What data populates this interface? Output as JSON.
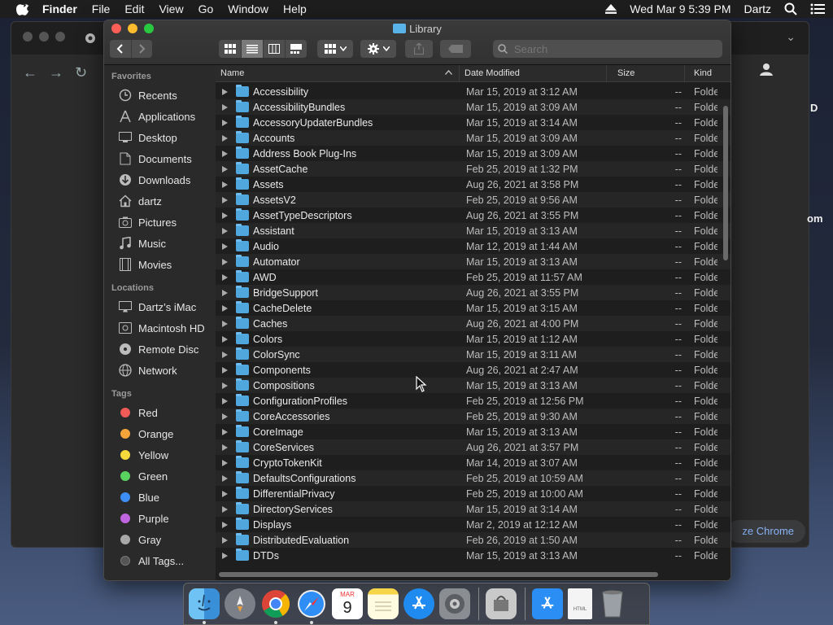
{
  "menubar": {
    "app": "Finder",
    "items": [
      "File",
      "Edit",
      "View",
      "Go",
      "Window",
      "Help"
    ],
    "datetime": "Wed Mar 9  5:39 PM",
    "user": "Dartz"
  },
  "chrome_background": {
    "edge_texts": [
      "D",
      "om"
    ],
    "customize_label": "ze Chrome"
  },
  "finder": {
    "title": "Library",
    "search_placeholder": "Search",
    "columns": {
      "name": "Name",
      "date": "Date Modified",
      "size": "Size",
      "kind": "Kind"
    },
    "sidebar": {
      "favorites_header": "Favorites",
      "favorites": [
        {
          "label": "Recents",
          "icon": "clock-icon"
        },
        {
          "label": "Applications",
          "icon": "applications-icon"
        },
        {
          "label": "Desktop",
          "icon": "desktop-icon"
        },
        {
          "label": "Documents",
          "icon": "document-icon"
        },
        {
          "label": "Downloads",
          "icon": "download-icon"
        },
        {
          "label": "dartz",
          "icon": "home-icon"
        },
        {
          "label": "Pictures",
          "icon": "camera-icon"
        },
        {
          "label": "Music",
          "icon": "music-icon"
        },
        {
          "label": "Movies",
          "icon": "film-icon"
        }
      ],
      "locations_header": "Locations",
      "locations": [
        {
          "label": "Dartz’s iMac",
          "icon": "imac-icon"
        },
        {
          "label": "Macintosh HD",
          "icon": "disk-icon"
        },
        {
          "label": "Remote Disc",
          "icon": "disc-icon"
        },
        {
          "label": "Network",
          "icon": "globe-icon"
        }
      ],
      "tags_header": "Tags",
      "tags": [
        {
          "label": "Red",
          "color": "#f05a57"
        },
        {
          "label": "Orange",
          "color": "#f7a43a"
        },
        {
          "label": "Yellow",
          "color": "#f5d93d"
        },
        {
          "label": "Green",
          "color": "#5ad25f"
        },
        {
          "label": "Blue",
          "color": "#3e8ff5"
        },
        {
          "label": "Purple",
          "color": "#c065e0"
        },
        {
          "label": "Gray",
          "color": "#a8a8a8"
        },
        {
          "label": "All Tags...",
          "color": "#555555"
        }
      ]
    },
    "rows": [
      {
        "name": "Accessibility",
        "date": "Mar 15, 2019 at 3:12 AM",
        "size": "--",
        "kind": "Folde"
      },
      {
        "name": "AccessibilityBundles",
        "date": "Mar 15, 2019 at 3:09 AM",
        "size": "--",
        "kind": "Folde"
      },
      {
        "name": "AccessoryUpdaterBundles",
        "date": "Mar 15, 2019 at 3:14 AM",
        "size": "--",
        "kind": "Folde"
      },
      {
        "name": "Accounts",
        "date": "Mar 15, 2019 at 3:09 AM",
        "size": "--",
        "kind": "Folde"
      },
      {
        "name": "Address Book Plug-Ins",
        "date": "Mar 15, 2019 at 3:09 AM",
        "size": "--",
        "kind": "Folde"
      },
      {
        "name": "AssetCache",
        "date": "Feb 25, 2019 at 1:32 PM",
        "size": "--",
        "kind": "Folde"
      },
      {
        "name": "Assets",
        "date": "Aug 26, 2021 at 3:58 PM",
        "size": "--",
        "kind": "Folde"
      },
      {
        "name": "AssetsV2",
        "date": "Feb 25, 2019 at 9:56 AM",
        "size": "--",
        "kind": "Folde"
      },
      {
        "name": "AssetTypeDescriptors",
        "date": "Aug 26, 2021 at 3:55 PM",
        "size": "--",
        "kind": "Folde"
      },
      {
        "name": "Assistant",
        "date": "Mar 15, 2019 at 3:13 AM",
        "size": "--",
        "kind": "Folde"
      },
      {
        "name": "Audio",
        "date": "Mar 12, 2019 at 1:44 AM",
        "size": "--",
        "kind": "Folde"
      },
      {
        "name": "Automator",
        "date": "Mar 15, 2019 at 3:13 AM",
        "size": "--",
        "kind": "Folde"
      },
      {
        "name": "AWD",
        "date": "Feb 25, 2019 at 11:57 AM",
        "size": "--",
        "kind": "Folde"
      },
      {
        "name": "BridgeSupport",
        "date": "Aug 26, 2021 at 3:55 PM",
        "size": "--",
        "kind": "Folde"
      },
      {
        "name": "CacheDelete",
        "date": "Mar 15, 2019 at 3:15 AM",
        "size": "--",
        "kind": "Folde"
      },
      {
        "name": "Caches",
        "date": "Aug 26, 2021 at 4:00 PM",
        "size": "--",
        "kind": "Folde"
      },
      {
        "name": "Colors",
        "date": "Mar 15, 2019 at 1:12 AM",
        "size": "--",
        "kind": "Folde"
      },
      {
        "name": "ColorSync",
        "date": "Mar 15, 2019 at 3:11 AM",
        "size": "--",
        "kind": "Folde"
      },
      {
        "name": "Components",
        "date": "Aug 26, 2021 at 2:47 AM",
        "size": "--",
        "kind": "Folde"
      },
      {
        "name": "Compositions",
        "date": "Mar 15, 2019 at 3:13 AM",
        "size": "--",
        "kind": "Folde"
      },
      {
        "name": "ConfigurationProfiles",
        "date": "Feb 25, 2019 at 12:56 PM",
        "size": "--",
        "kind": "Folde"
      },
      {
        "name": "CoreAccessories",
        "date": "Feb 25, 2019 at 9:30 AM",
        "size": "--",
        "kind": "Folde"
      },
      {
        "name": "CoreImage",
        "date": "Mar 15, 2019 at 3:13 AM",
        "size": "--",
        "kind": "Folde"
      },
      {
        "name": "CoreServices",
        "date": "Aug 26, 2021 at 3:57 PM",
        "size": "--",
        "kind": "Folde"
      },
      {
        "name": "CryptoTokenKit",
        "date": "Mar 14, 2019 at 3:07 AM",
        "size": "--",
        "kind": "Folde"
      },
      {
        "name": "DefaultsConfigurations",
        "date": "Feb 25, 2019 at 10:59 AM",
        "size": "--",
        "kind": "Folde"
      },
      {
        "name": "DifferentialPrivacy",
        "date": "Feb 25, 2019 at 10:00 AM",
        "size": "--",
        "kind": "Folde"
      },
      {
        "name": "DirectoryServices",
        "date": "Mar 15, 2019 at 3:14 AM",
        "size": "--",
        "kind": "Folde"
      },
      {
        "name": "Displays",
        "date": "Mar 2, 2019 at 12:12 AM",
        "size": "--",
        "kind": "Folde"
      },
      {
        "name": "DistributedEvaluation",
        "date": "Feb 26, 2019 at 1:50 AM",
        "size": "--",
        "kind": "Folde"
      },
      {
        "name": "DTDs",
        "date": "Mar 15, 2019 at 3:13 AM",
        "size": "--",
        "kind": "Folde"
      }
    ]
  },
  "dock": {
    "calendar_month": "MAR",
    "calendar_day": "9",
    "apps": [
      "finder-icon",
      "launchpad-icon",
      "chrome-icon",
      "safari-icon",
      "calendar-icon",
      "notes-icon",
      "app-store-icon",
      "system-preferences-icon",
      "utility-icon",
      "applications-folder-icon",
      "html-document-icon",
      "trash-icon"
    ]
  }
}
